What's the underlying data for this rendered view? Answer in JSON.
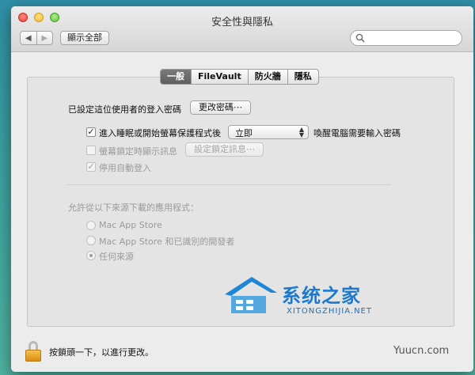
{
  "window": {
    "title": "安全性與隱私"
  },
  "toolbar": {
    "back_icon": "chevron-left-icon",
    "forward_icon": "chevron-right-icon",
    "show_all": "顯示全部",
    "search_placeholder": ""
  },
  "tabs": [
    {
      "label": "一般",
      "active": true
    },
    {
      "label": "FileVault",
      "active": false
    },
    {
      "label": "防火牆",
      "active": false
    },
    {
      "label": "隱私",
      "active": false
    }
  ],
  "general": {
    "password_set_label": "已設定這位使用者的登入密碼",
    "change_password_button": "更改密碼⋯",
    "require_password": {
      "checked": true,
      "label_before": "進入睡眠或開始螢幕保護程式後",
      "delay_value": "立即",
      "label_after": "喚醒電腦需要輸入密碼"
    },
    "show_message": {
      "checked": false,
      "enabled": false,
      "label": "螢幕鎖定時顯示訊息"
    },
    "set_lock_message_button": "設定鎖定訊息⋯",
    "disable_auto_login": {
      "checked": true,
      "enabled": false,
      "label": "停用自動登入"
    },
    "allow_apps_label": "允許從以下來源下載的應用程式：",
    "sources": [
      {
        "label": "Mac App Store",
        "selected": false
      },
      {
        "label": "Mac App Store 和已識別的開發者",
        "selected": false
      },
      {
        "label": "任何來源",
        "selected": true
      }
    ]
  },
  "footer": {
    "lock_text": "按鎖頭一下，以進行更改。",
    "lock_icon": "lock-icon"
  },
  "watermark": {
    "text": "系统之家",
    "sub": "XITONGZHIJIA.NET",
    "corner": "Yuucn.com"
  },
  "colors": {
    "accent": "#1b7ad0",
    "tab_active": "#6b6b6b"
  }
}
